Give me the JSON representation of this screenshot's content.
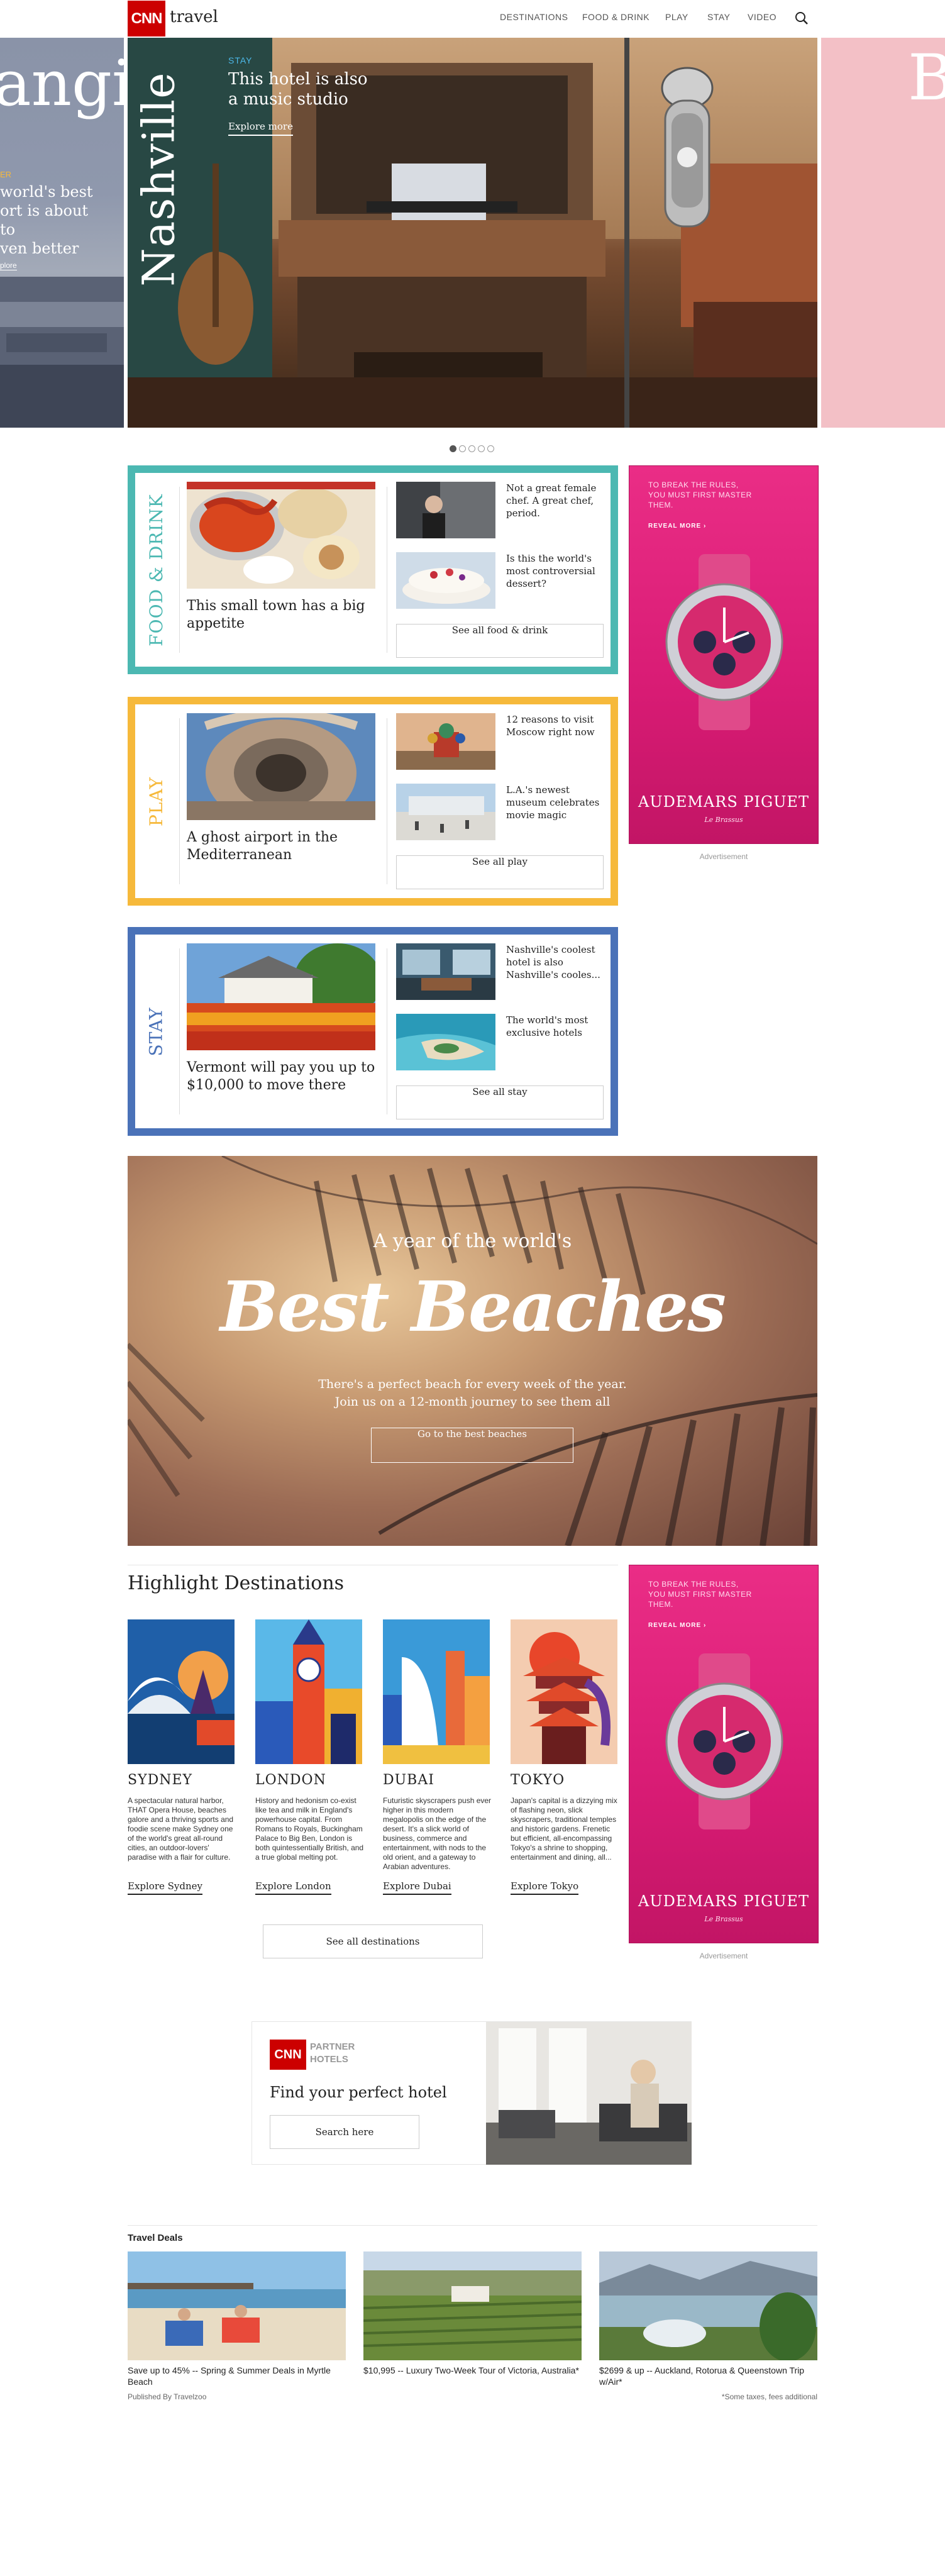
{
  "header": {
    "logo": "CNN",
    "brand": "travel",
    "nav": [
      "DESTINATIONS",
      "FOOD & DRINK",
      "PLAY",
      "STAY",
      "VIDEO"
    ]
  },
  "hero": {
    "left_title": "angi",
    "left_tag": "ER",
    "left_text": "world's best\nort is about to\nven better",
    "left_link": "plore",
    "city": "Nashville",
    "tag": "STAY",
    "headline": "This hotel is also a music studio",
    "cta": "Explore more",
    "right_title": "B",
    "carousel_count": 5,
    "carousel_active": 0
  },
  "sections": [
    {
      "label": "FOOD & DRINK",
      "color": "#4cb8b2",
      "main_title": "This small town has a big appetite",
      "items": [
        "Not a great female chef. A great chef, period.",
        "Is this the world's most controversial dessert?"
      ],
      "see_all": "See all food & drink"
    },
    {
      "label": "PLAY",
      "color": "#f6b93b",
      "main_title": "A ghost airport in the Mediterranean",
      "items": [
        "12 reasons to visit Moscow right now",
        "L.A.'s newest museum celebrates movie magic"
      ],
      "see_all": "See all play"
    },
    {
      "label": "STAY",
      "color": "#4a72b8",
      "main_title": "Vermont will pay you up to $10,000 to move there",
      "items": [
        "Nashville's coolest hotel is also Nashville's cooles...",
        "The world's most exclusive hotels"
      ],
      "see_all": "See all stay"
    }
  ],
  "ad": {
    "tagline": "TO BREAK THE RULES,\nYOU MUST FIRST MASTER\nTHEM.",
    "reveal": "REVEAL MORE  ›",
    "brand": "AUDEMARS PIGUET",
    "brand_sub": "Le Brassus",
    "label": "Advertisement"
  },
  "beaches": {
    "kicker": "A year of the world's",
    "title": "Best Beaches",
    "text_line1": "There's a perfect beach for every week of the year.",
    "text_line2": "Join us on a 12-month journey to see them all",
    "cta": "Go to the best beaches"
  },
  "highlight": {
    "title": "Highlight Destinations",
    "destinations": [
      {
        "name": "SYDNEY",
        "desc": "A spectacular natural harbor, THAT Opera House, beaches galore and a thriving sports and foodie scene make Sydney one of the world's great all-round cities, an outdoor-lovers' paradise with a flair for culture.",
        "link": "Explore Sydney"
      },
      {
        "name": "LONDON",
        "desc": "History and hedonism co-exist like tea and milk in England's powerhouse capital. From Romans to Royals, Buckingham Palace to Big Ben, London is both quintessentially British, and a true global melting pot.",
        "link": "Explore London"
      },
      {
        "name": "DUBAI",
        "desc": "Futuristic skyscrapers push ever higher in this modern megalopolis on the edge of the desert. It's a slick world of business, commerce and entertainment, with nods to the old orient, and a gateway to Arabian adventures.",
        "link": "Explore Dubai"
      },
      {
        "name": "TOKYO",
        "desc": "Japan's capital is a dizzying mix of flashing neon, slick skyscrapers, traditional temples and historic gardens. Frenetic but efficient, all-encompassing Tokyo's a shrine to shopping, entertainment and dining, all...",
        "link": "Explore Tokyo"
      }
    ],
    "see_all": "See all destinations"
  },
  "partner": {
    "logo": "CNN",
    "label1": "PARTNER",
    "label2": "HOTELS",
    "title": "Find your perfect hotel",
    "cta": "Search here"
  },
  "deals": {
    "title": "Travel Deals",
    "items": [
      "Save up to 45% -- Spring & Summer Deals in Myrtle Beach",
      "$10,995 -- Luxury Two-Week Tour of Victoria, Australia*",
      "$2699 & up -- Auckland, Rotorua & Queenstown Trip w/Air*"
    ],
    "published": "Published By Travelzoo",
    "note": "*Some taxes, fees additional"
  }
}
